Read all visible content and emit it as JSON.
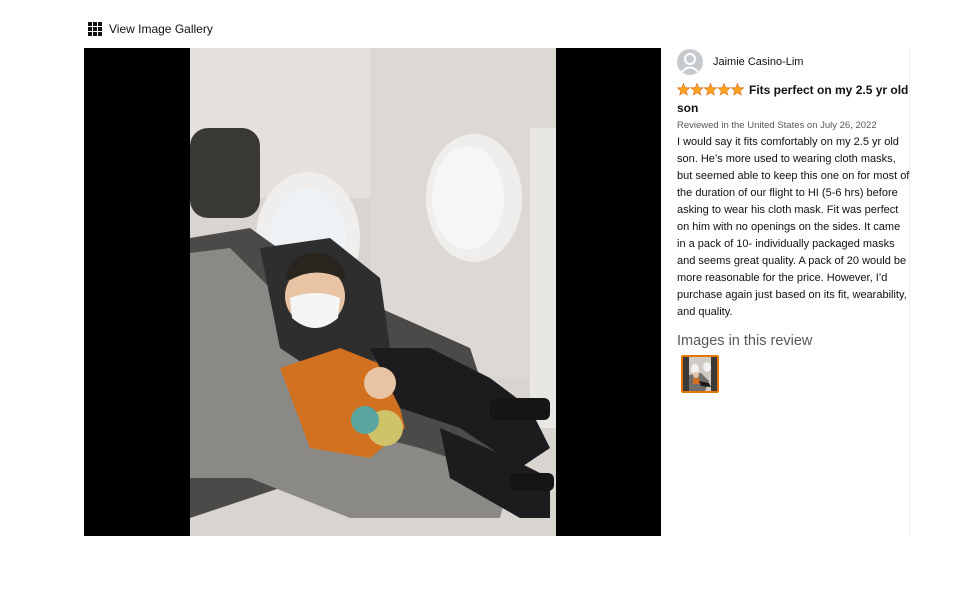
{
  "gallery": {
    "link_label": "View Image Gallery",
    "icon": "grid-icon"
  },
  "photo": {
    "subject": "review-photo"
  },
  "review": {
    "reviewer_name": "Jaimie Casino-Lim",
    "rating": 5,
    "rating_max": 5,
    "title": "Fits perfect on my 2.5 yr old son",
    "meta": "Reviewed in the United States on July 26, 2022",
    "body": "I would say it fits comfortably on my 2.5 yr old son. He’s more used to wearing cloth masks, but seemed able to keep this one on for most of the duration of our flight to HI (5-6 hrs) before asking to wear his cloth mask. Fit was perfect on him with no openings on the sides. It came in a pack of 10- individually packaged masks and seems great quality. A pack of 20 would be more reasonable for the price. However, I’d purchase again just based on its fit, wearability, and quality.",
    "images_heading": "Images in this review",
    "star_color": "#ffa41c",
    "thumb_border_color": "#e77600"
  }
}
